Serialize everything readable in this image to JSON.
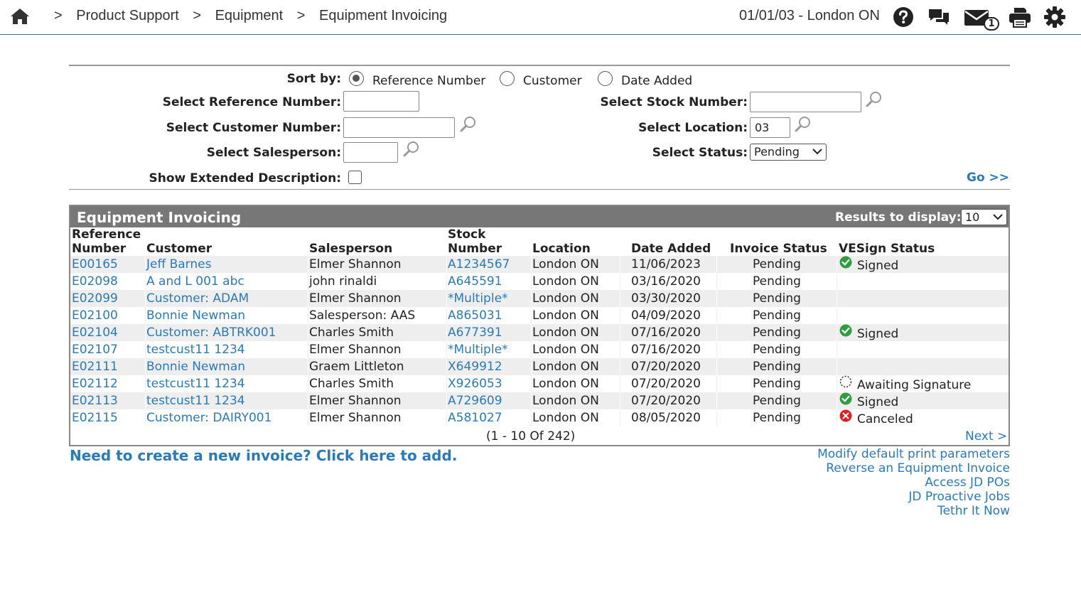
{
  "breadcrumbs": {
    "separator": ">",
    "items": [
      "Product Support",
      "Equipment",
      "Equipment Invoicing"
    ]
  },
  "header": {
    "date_location": "01/01/03 - London ON",
    "mail_count": "1"
  },
  "filters": {
    "sort_label": "Sort by:",
    "sort_options": [
      "Reference Number",
      "Customer",
      "Date Added"
    ],
    "sort_selected": "Reference Number",
    "ref_label": "Select Reference Number:",
    "ref_value": "",
    "customer_label": "Select Customer Number:",
    "customer_value": "",
    "salesperson_label": "Select Salesperson:",
    "salesperson_value": "",
    "extended_label": "Show Extended Description:",
    "extended_checked": false,
    "stock_label": "Select Stock Number:",
    "stock_value": "",
    "location_label": "Select Location:",
    "location_value": "03",
    "status_label": "Select Status:",
    "status_value": "Pending",
    "go_label": "Go >>"
  },
  "grid": {
    "title": "Equipment Invoicing",
    "results_label": "Results to display:",
    "results_value": "10",
    "columns": {
      "reference": [
        "Reference",
        "Number"
      ],
      "customer": "Customer",
      "salesperson": "Salesperson",
      "stock": [
        "Stock",
        "Number"
      ],
      "location": "Location",
      "date_added": "Date Added",
      "invoice_status": "Invoice Status",
      "vesign_status": "VESign Status"
    },
    "rows": [
      {
        "ref": "E00165",
        "customer": "Jeff Barnes",
        "salesperson": "Elmer Shannon",
        "stock": "A1234567",
        "location": "London ON",
        "date": "11/06/2023",
        "status": "Pending",
        "vesign": "Signed",
        "vesign_icon": "check-icon"
      },
      {
        "ref": "E02098",
        "customer": "A and L 001 abc",
        "salesperson": "john rinaldi",
        "stock": "A645591",
        "location": "London ON",
        "date": "03/16/2020",
        "status": "Pending",
        "vesign": "",
        "vesign_icon": ""
      },
      {
        "ref": "E02099",
        "customer": "Customer: ADAM",
        "salesperson": "Elmer Shannon",
        "stock": "*Multiple*",
        "location": "London ON",
        "date": "03/30/2020",
        "status": "Pending",
        "vesign": "",
        "vesign_icon": ""
      },
      {
        "ref": "E02100",
        "customer": "Bonnie Newman",
        "salesperson": "Salesperson: AAS",
        "stock": "A865031",
        "location": "London ON",
        "date": "04/09/2020",
        "status": "Pending",
        "vesign": "",
        "vesign_icon": ""
      },
      {
        "ref": "E02104",
        "customer": "Customer: ABTRK001",
        "salesperson": "Charles Smith",
        "stock": "A677391",
        "location": "London ON",
        "date": "07/16/2020",
        "status": "Pending",
        "vesign": "Signed",
        "vesign_icon": "check-icon"
      },
      {
        "ref": "E02107",
        "customer": "testcust11 1234",
        "salesperson": "Elmer Shannon",
        "stock": "*Multiple*",
        "location": "London ON",
        "date": "07/16/2020",
        "status": "Pending",
        "vesign": "",
        "vesign_icon": ""
      },
      {
        "ref": "E02111",
        "customer": "Bonnie Newman",
        "salesperson": "Graem Littleton",
        "stock": "X649912",
        "location": "London ON",
        "date": "07/20/2020",
        "status": "Pending",
        "vesign": "",
        "vesign_icon": ""
      },
      {
        "ref": "E02112",
        "customer": "testcust11 1234",
        "salesperson": "Charles Smith",
        "stock": "X926053",
        "location": "London ON",
        "date": "07/20/2020",
        "status": "Pending",
        "vesign": "Awaiting Signature",
        "vesign_icon": "pending-icon"
      },
      {
        "ref": "E02113",
        "customer": "testcust11 1234",
        "salesperson": "Elmer Shannon",
        "stock": "A729609",
        "location": "London ON",
        "date": "07/20/2020",
        "status": "Pending",
        "vesign": "Signed",
        "vesign_icon": "check-icon"
      },
      {
        "ref": "E02115",
        "customer": "Customer: DAIRY001",
        "salesperson": "Elmer Shannon",
        "stock": "A581027",
        "location": "London ON",
        "date": "08/05/2020",
        "status": "Pending",
        "vesign": "Canceled",
        "vesign_icon": "cancel-icon"
      }
    ],
    "pager": "(1  -  10  Of  242)",
    "next_label": "Next >"
  },
  "footer": {
    "add_link": "Need to create a new invoice? Click here to add.",
    "links": [
      "Modify default print parameters",
      "Reverse an Equipment Invoice",
      "Access JD POs",
      "JD Proactive Jobs",
      "Tethr It Now"
    ]
  },
  "colors": {
    "link": "#2a7ab8",
    "header_bar": "#777777",
    "signed": "#2e9e3e",
    "canceled": "#e02020"
  }
}
